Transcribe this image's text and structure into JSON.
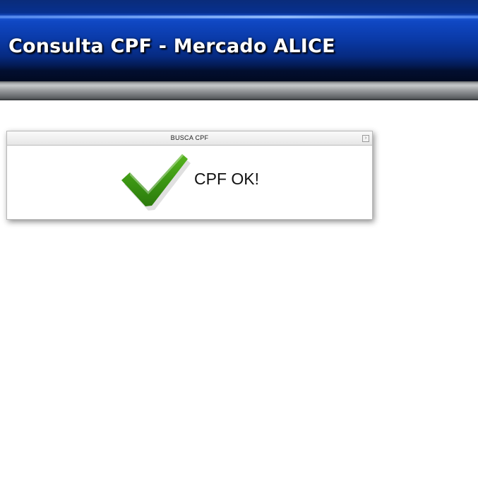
{
  "header": {
    "title": "Consulta CPF - Mercado ALICE"
  },
  "panel": {
    "title": "BUSCA CPF",
    "collapse_icon": "panel-toggle-icon",
    "status_icon": "checkmark-icon",
    "message": "CPF OK!"
  },
  "colors": {
    "header_blue": "#0a3aa8",
    "check_green": "#3f9b16"
  }
}
